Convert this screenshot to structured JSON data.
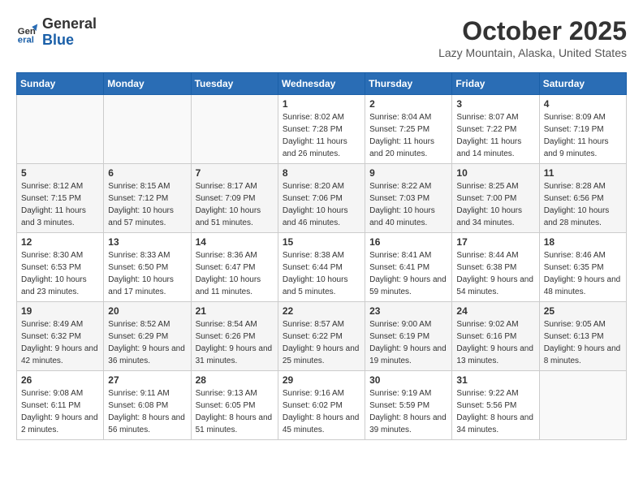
{
  "header": {
    "logo_line1": "General",
    "logo_line2": "Blue",
    "month": "October 2025",
    "location": "Lazy Mountain, Alaska, United States"
  },
  "weekdays": [
    "Sunday",
    "Monday",
    "Tuesday",
    "Wednesday",
    "Thursday",
    "Friday",
    "Saturday"
  ],
  "weeks": [
    [
      {
        "day": "",
        "sunrise": "",
        "sunset": "",
        "daylight": ""
      },
      {
        "day": "",
        "sunrise": "",
        "sunset": "",
        "daylight": ""
      },
      {
        "day": "",
        "sunrise": "",
        "sunset": "",
        "daylight": ""
      },
      {
        "day": "1",
        "sunrise": "Sunrise: 8:02 AM",
        "sunset": "Sunset: 7:28 PM",
        "daylight": "Daylight: 11 hours and 26 minutes."
      },
      {
        "day": "2",
        "sunrise": "Sunrise: 8:04 AM",
        "sunset": "Sunset: 7:25 PM",
        "daylight": "Daylight: 11 hours and 20 minutes."
      },
      {
        "day": "3",
        "sunrise": "Sunrise: 8:07 AM",
        "sunset": "Sunset: 7:22 PM",
        "daylight": "Daylight: 11 hours and 14 minutes."
      },
      {
        "day": "4",
        "sunrise": "Sunrise: 8:09 AM",
        "sunset": "Sunset: 7:19 PM",
        "daylight": "Daylight: 11 hours and 9 minutes."
      }
    ],
    [
      {
        "day": "5",
        "sunrise": "Sunrise: 8:12 AM",
        "sunset": "Sunset: 7:15 PM",
        "daylight": "Daylight: 11 hours and 3 minutes."
      },
      {
        "day": "6",
        "sunrise": "Sunrise: 8:15 AM",
        "sunset": "Sunset: 7:12 PM",
        "daylight": "Daylight: 10 hours and 57 minutes."
      },
      {
        "day": "7",
        "sunrise": "Sunrise: 8:17 AM",
        "sunset": "Sunset: 7:09 PM",
        "daylight": "Daylight: 10 hours and 51 minutes."
      },
      {
        "day": "8",
        "sunrise": "Sunrise: 8:20 AM",
        "sunset": "Sunset: 7:06 PM",
        "daylight": "Daylight: 10 hours and 46 minutes."
      },
      {
        "day": "9",
        "sunrise": "Sunrise: 8:22 AM",
        "sunset": "Sunset: 7:03 PM",
        "daylight": "Daylight: 10 hours and 40 minutes."
      },
      {
        "day": "10",
        "sunrise": "Sunrise: 8:25 AM",
        "sunset": "Sunset: 7:00 PM",
        "daylight": "Daylight: 10 hours and 34 minutes."
      },
      {
        "day": "11",
        "sunrise": "Sunrise: 8:28 AM",
        "sunset": "Sunset: 6:56 PM",
        "daylight": "Daylight: 10 hours and 28 minutes."
      }
    ],
    [
      {
        "day": "12",
        "sunrise": "Sunrise: 8:30 AM",
        "sunset": "Sunset: 6:53 PM",
        "daylight": "Daylight: 10 hours and 23 minutes."
      },
      {
        "day": "13",
        "sunrise": "Sunrise: 8:33 AM",
        "sunset": "Sunset: 6:50 PM",
        "daylight": "Daylight: 10 hours and 17 minutes."
      },
      {
        "day": "14",
        "sunrise": "Sunrise: 8:36 AM",
        "sunset": "Sunset: 6:47 PM",
        "daylight": "Daylight: 10 hours and 11 minutes."
      },
      {
        "day": "15",
        "sunrise": "Sunrise: 8:38 AM",
        "sunset": "Sunset: 6:44 PM",
        "daylight": "Daylight: 10 hours and 5 minutes."
      },
      {
        "day": "16",
        "sunrise": "Sunrise: 8:41 AM",
        "sunset": "Sunset: 6:41 PM",
        "daylight": "Daylight: 9 hours and 59 minutes."
      },
      {
        "day": "17",
        "sunrise": "Sunrise: 8:44 AM",
        "sunset": "Sunset: 6:38 PM",
        "daylight": "Daylight: 9 hours and 54 minutes."
      },
      {
        "day": "18",
        "sunrise": "Sunrise: 8:46 AM",
        "sunset": "Sunset: 6:35 PM",
        "daylight": "Daylight: 9 hours and 48 minutes."
      }
    ],
    [
      {
        "day": "19",
        "sunrise": "Sunrise: 8:49 AM",
        "sunset": "Sunset: 6:32 PM",
        "daylight": "Daylight: 9 hours and 42 minutes."
      },
      {
        "day": "20",
        "sunrise": "Sunrise: 8:52 AM",
        "sunset": "Sunset: 6:29 PM",
        "daylight": "Daylight: 9 hours and 36 minutes."
      },
      {
        "day": "21",
        "sunrise": "Sunrise: 8:54 AM",
        "sunset": "Sunset: 6:26 PM",
        "daylight": "Daylight: 9 hours and 31 minutes."
      },
      {
        "day": "22",
        "sunrise": "Sunrise: 8:57 AM",
        "sunset": "Sunset: 6:22 PM",
        "daylight": "Daylight: 9 hours and 25 minutes."
      },
      {
        "day": "23",
        "sunrise": "Sunrise: 9:00 AM",
        "sunset": "Sunset: 6:19 PM",
        "daylight": "Daylight: 9 hours and 19 minutes."
      },
      {
        "day": "24",
        "sunrise": "Sunrise: 9:02 AM",
        "sunset": "Sunset: 6:16 PM",
        "daylight": "Daylight: 9 hours and 13 minutes."
      },
      {
        "day": "25",
        "sunrise": "Sunrise: 9:05 AM",
        "sunset": "Sunset: 6:13 PM",
        "daylight": "Daylight: 9 hours and 8 minutes."
      }
    ],
    [
      {
        "day": "26",
        "sunrise": "Sunrise: 9:08 AM",
        "sunset": "Sunset: 6:11 PM",
        "daylight": "Daylight: 9 hours and 2 minutes."
      },
      {
        "day": "27",
        "sunrise": "Sunrise: 9:11 AM",
        "sunset": "Sunset: 6:08 PM",
        "daylight": "Daylight: 8 hours and 56 minutes."
      },
      {
        "day": "28",
        "sunrise": "Sunrise: 9:13 AM",
        "sunset": "Sunset: 6:05 PM",
        "daylight": "Daylight: 8 hours and 51 minutes."
      },
      {
        "day": "29",
        "sunrise": "Sunrise: 9:16 AM",
        "sunset": "Sunset: 6:02 PM",
        "daylight": "Daylight: 8 hours and 45 minutes."
      },
      {
        "day": "30",
        "sunrise": "Sunrise: 9:19 AM",
        "sunset": "Sunset: 5:59 PM",
        "daylight": "Daylight: 8 hours and 39 minutes."
      },
      {
        "day": "31",
        "sunrise": "Sunrise: 9:22 AM",
        "sunset": "Sunset: 5:56 PM",
        "daylight": "Daylight: 8 hours and 34 minutes."
      },
      {
        "day": "",
        "sunrise": "",
        "sunset": "",
        "daylight": ""
      }
    ]
  ]
}
